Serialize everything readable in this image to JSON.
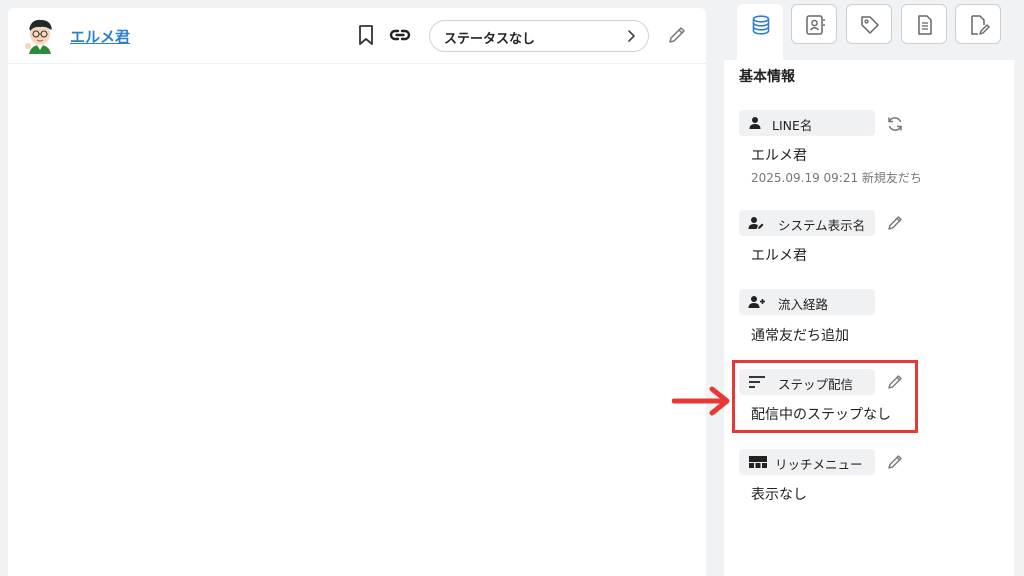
{
  "header": {
    "user_name": "エルメ君",
    "status_label": "ステータスなし"
  },
  "side_tabs": [
    "database-icon",
    "contact-icon",
    "tag-icon",
    "document-icon",
    "edit-document-icon"
  ],
  "panel": {
    "section_title": "基本情報",
    "line_name": {
      "label": "LINE名",
      "value": "エルメ君",
      "meta": "2025.09.19 09:21 新規友だち"
    },
    "system_name": {
      "label": "システム表示名",
      "value": "エルメ君"
    },
    "inflow": {
      "label": "流入経路",
      "value": "通常友だち追加"
    },
    "step": {
      "label": "ステップ配信",
      "value": "配信中のステップなし"
    },
    "rich_menu": {
      "label": "リッチメニュー",
      "value": "表示なし"
    }
  },
  "colors": {
    "accent_blue": "#2f7fd0",
    "highlight_red": "#e53935"
  }
}
